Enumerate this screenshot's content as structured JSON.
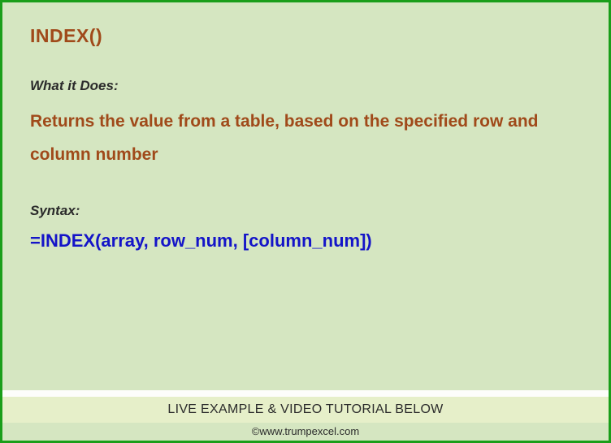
{
  "function_name": "INDEX()",
  "labels": {
    "what_it_does": "What it Does:",
    "syntax": "Syntax:"
  },
  "description": "Returns the value from a table, based on the specified row and column number",
  "syntax_text": "=INDEX(array, row_num, [column_num])",
  "footer": {
    "banner": "LIVE EXAMPLE & VIDEO TUTORIAL BELOW",
    "credit": "©www.trumpexcel.com"
  }
}
